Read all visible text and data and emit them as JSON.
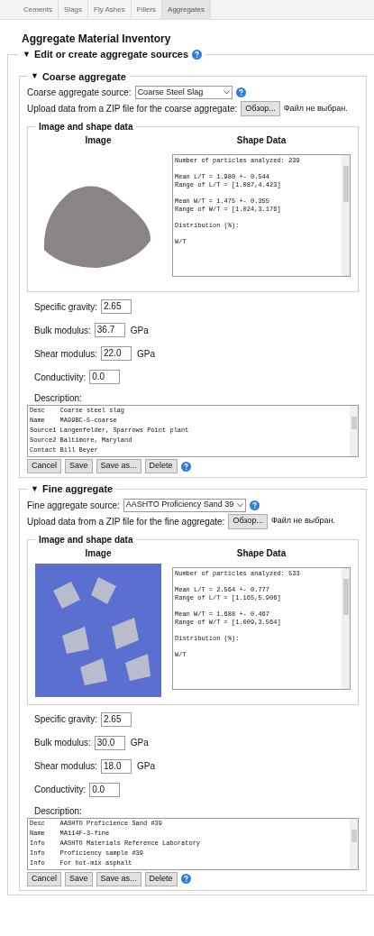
{
  "tabs": [
    {
      "label": "Cements",
      "selected": false
    },
    {
      "label": "Slags",
      "selected": false
    },
    {
      "label": "Fly Ashes",
      "selected": false
    },
    {
      "label": "Fillers",
      "selected": false
    },
    {
      "label": "Aggregates",
      "selected": true
    }
  ],
  "title": "Aggregate Material Inventory",
  "section": {
    "toggle": "▼",
    "legend": "Edit or create aggregate sources",
    "expanded": true
  },
  "aggregates": [
    {
      "kind": "coarse",
      "toggle": "▼",
      "legend": "Coarse aggregate",
      "expanded": true,
      "source_label": "Coarse aggregate source:",
      "source_value": "Coarse Steel Slag",
      "upload_label": "Upload data from a ZIP file for the coarse aggregate:",
      "browse_button": "Обзор...",
      "file_status": "Файл не выбран.",
      "shape_legend": "Image and shape data",
      "image_heading": "Image",
      "shape_heading": "Shape Data",
      "shape_text": "Number of particles analyzed: 239\n\nMean L/T = 1.980 +- 0.544\nRange of L/T = [1.087,4.423]\n\nMean W/T = 1.475 +- 0.355\nRange of W/T = [1.024,3.176]\n\nDistribution (%):\n\nW/T",
      "properties": [
        {
          "label": "Specific gravity:",
          "value": "2.65"
        },
        {
          "label": "Bulk modulus:",
          "value": "36.7",
          "unit": "GPa"
        },
        {
          "label": "Shear modulus:",
          "value": "22.0",
          "unit": "GPa"
        },
        {
          "label": "Conductivity:",
          "value": "0.0"
        }
      ],
      "description_label": "Description:",
      "description": "Desc    Coarse steel slag\nName    MA99BC-5-coarse\nSource1 Langenfelder, Sparrows Point plant\nSource2 Baltimore, Maryland\nContact Bill Beyer",
      "buttons": [
        "Cancel",
        "Save",
        "Save as...",
        "Delete"
      ]
    },
    {
      "kind": "fine",
      "toggle": "▼",
      "legend": "Fine aggregate",
      "expanded": true,
      "source_label": "Fine aggregate source:",
      "source_value": "AASHTO Proficiency Sand 39",
      "upload_label": "Upload data from a ZIP file for the fine aggregate:",
      "browse_button": "Обзор...",
      "file_status": "Файл не выбран.",
      "shape_legend": "Image and shape data",
      "image_heading": "Image",
      "shape_heading": "Shape Data",
      "shape_text": "Number of particles analyzed: 533\n\nMean L/T = 2.564 +- 0.777\nRange of L/T = [1.165,5.906]\n\nMean W/T = 1.688 +- 0.467\nRange of W/T = [1.009,3.564]\n\nDistribution (%):\n\nW/T",
      "properties": [
        {
          "label": "Specific gravity:",
          "value": "2.65"
        },
        {
          "label": "Bulk modulus:",
          "value": "30.0",
          "unit": "GPa"
        },
        {
          "label": "Shear modulus:",
          "value": "18.0",
          "unit": "GPa"
        },
        {
          "label": "Conductivity:",
          "value": "0.0"
        }
      ],
      "description_label": "Description:",
      "description": "Desc    AASHTO Proficience Sand #39\nName    MA114F-3-fine\nInfo    AASHTO Materials Reference Laboratory\nInfo    Proficiency sample #39\nInfo    For hot-mix asphalt",
      "buttons": [
        "Cancel",
        "Save",
        "Save as...",
        "Delete"
      ]
    }
  ]
}
